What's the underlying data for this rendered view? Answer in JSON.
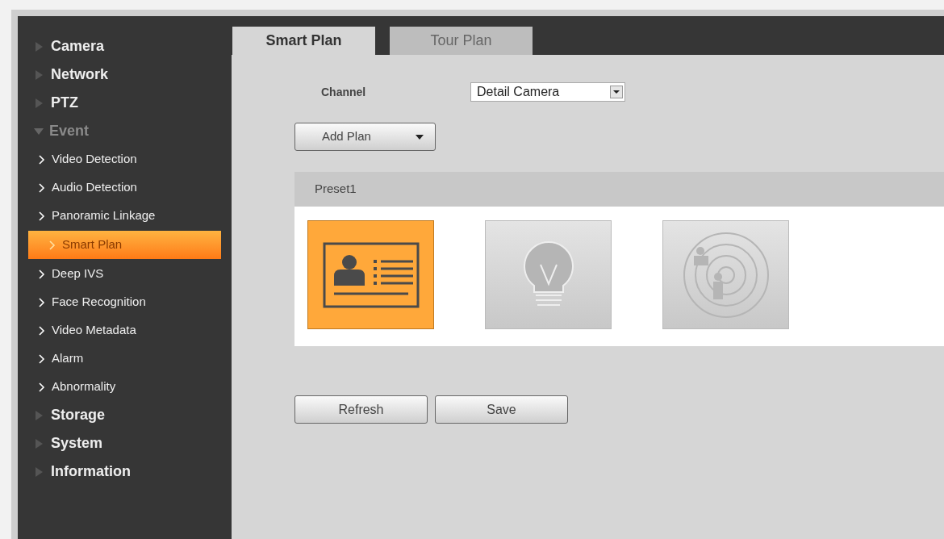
{
  "sidebar": {
    "items": [
      {
        "label": "Camera",
        "expanded": false
      },
      {
        "label": "Network",
        "expanded": false
      },
      {
        "label": "PTZ",
        "expanded": false
      },
      {
        "label": "Event",
        "expanded": true,
        "children": [
          {
            "label": "Video Detection",
            "selected": false
          },
          {
            "label": "Audio Detection",
            "selected": false
          },
          {
            "label": "Panoramic Linkage",
            "selected": false
          },
          {
            "label": "Smart Plan",
            "selected": true
          },
          {
            "label": "Deep IVS",
            "selected": false
          },
          {
            "label": "Face Recognition",
            "selected": false
          },
          {
            "label": "Video Metadata",
            "selected": false
          },
          {
            "label": "Alarm",
            "selected": false
          },
          {
            "label": "Abnormality",
            "selected": false
          }
        ]
      },
      {
        "label": "Storage",
        "expanded": false
      },
      {
        "label": "System",
        "expanded": false
      },
      {
        "label": "Information",
        "expanded": false
      }
    ]
  },
  "tabs": [
    {
      "label": "Smart Plan",
      "selected": true
    },
    {
      "label": "Tour Plan",
      "selected": false
    }
  ],
  "channel": {
    "label": "Channel",
    "value": "Detail Camera"
  },
  "add_plan_button": "Add Plan",
  "preset": {
    "title": "Preset1",
    "plans": [
      {
        "kind": "face",
        "selected": true
      },
      {
        "kind": "bulb",
        "selected": false
      },
      {
        "kind": "radar",
        "selected": false
      }
    ]
  },
  "buttons": [
    "Refresh",
    "Save"
  ]
}
